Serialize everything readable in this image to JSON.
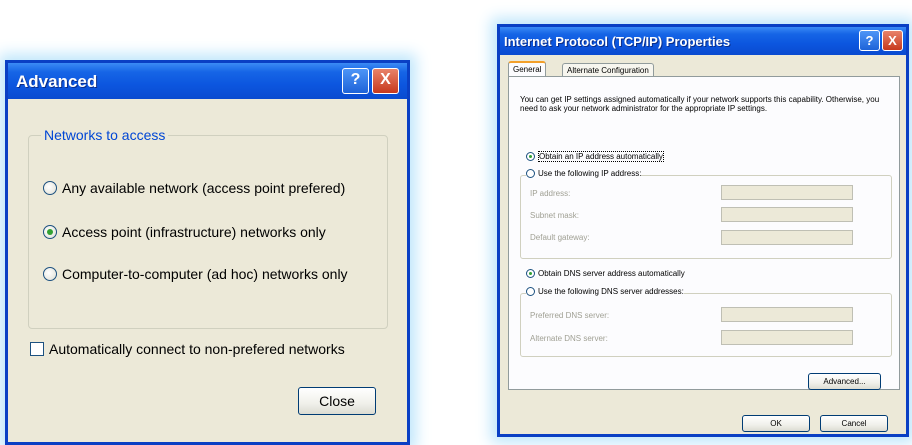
{
  "advanced_dialog": {
    "title": "Advanced",
    "help_button": "?",
    "close_x": "X",
    "group_title": "Networks to access",
    "options": [
      {
        "label": "Any available network (access point prefered)",
        "selected": false
      },
      {
        "label": "Access point (infrastructure) networks only",
        "selected": true
      },
      {
        "label": "Computer-to-computer (ad hoc) networks only",
        "selected": false
      }
    ],
    "checkbox_label": "Automatically connect to non-prefered networks",
    "close_button": "Close"
  },
  "tcp_dialog": {
    "title": "Internet Protocol (TCP/IP) Properties",
    "help_button": "?",
    "close_x": "X",
    "tabs": [
      "General",
      "Alternate Configuration"
    ],
    "description": "You can get IP settings assigned automatically if your network supports this capability. Otherwise, you need to ask your network administrator for the appropriate IP settings.",
    "ip_auto": "Obtain an IP address automatically",
    "ip_manual": "Use the following IP address:",
    "ip_fields": [
      "IP address:",
      "Subnet mask:",
      "Default gateway:"
    ],
    "dns_auto": "Obtain DNS server address automatically",
    "dns_manual": "Use the following DNS server addresses:",
    "dns_fields": [
      "Preferred DNS server:",
      "Alternate DNS server:"
    ],
    "advanced_button": "Advanced...",
    "ok_button": "OK",
    "cancel_button": "Cancel"
  }
}
